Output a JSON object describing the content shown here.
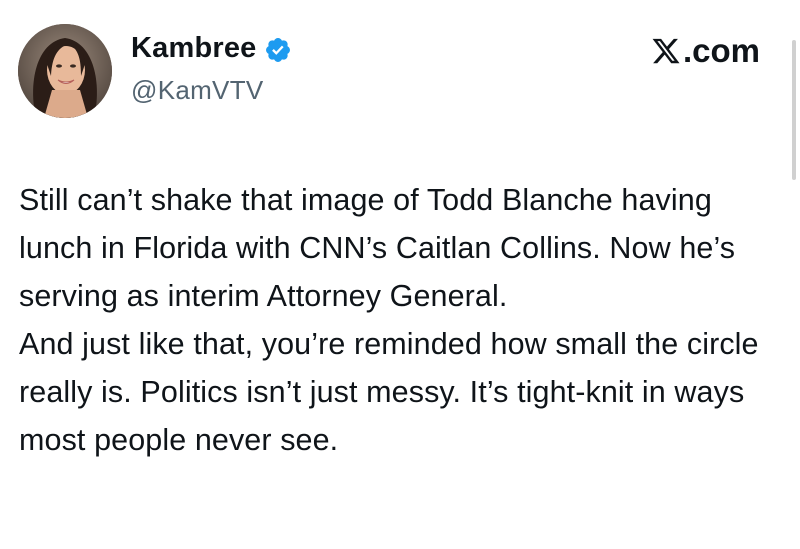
{
  "author": {
    "display_name": "Kambree",
    "handle": "@KamVTV",
    "verified": true,
    "verified_color": "#1d9bf0",
    "avatar_icon": "profile-photo"
  },
  "source": {
    "logo_icon": "x-logo-icon",
    "suffix": ".com"
  },
  "tweet": {
    "paragraphs": [
      "Still can’t shake that image of Todd Blanche having lunch in Florida with CNN’s Caitlan Collins. Now he’s serving as interim Attorney General.",
      "And just like that, you’re reminded how small the circle really is. Politics isn’t just messy. It’s tight-knit in ways most people never see."
    ]
  },
  "colors": {
    "text_primary": "#0f1419",
    "text_secondary": "#536471",
    "background": "#ffffff"
  }
}
